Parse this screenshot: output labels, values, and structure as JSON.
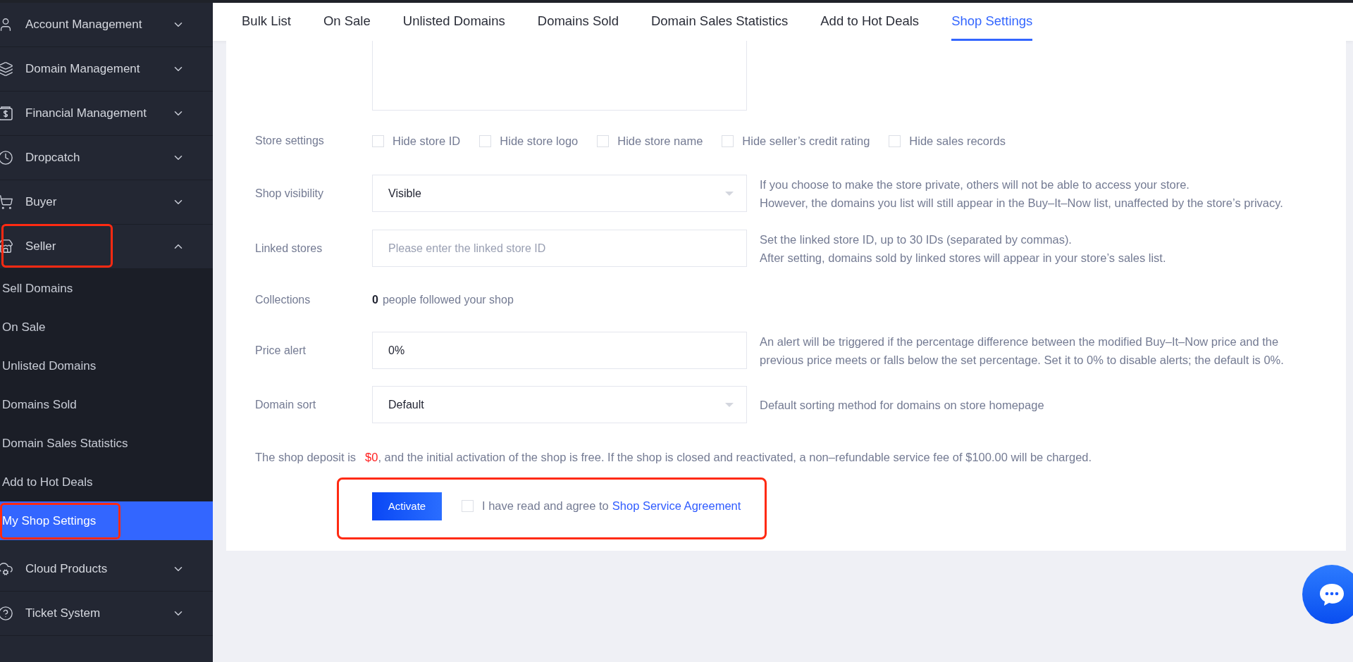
{
  "sidebar": {
    "items": [
      {
        "label": "Account Management",
        "expanded": false,
        "highlighted": false
      },
      {
        "label": "Domain Management",
        "expanded": false,
        "highlighted": false
      },
      {
        "label": "Financial Management",
        "expanded": false,
        "highlighted": false
      },
      {
        "label": "Dropcatch",
        "expanded": false,
        "highlighted": false
      },
      {
        "label": "Buyer",
        "expanded": false,
        "highlighted": false
      },
      {
        "label": "Seller",
        "expanded": true,
        "highlighted": true,
        "children": [
          {
            "label": "Sell Domains",
            "selected": false,
            "highlighted": false
          },
          {
            "label": "On Sale",
            "selected": false,
            "highlighted": false
          },
          {
            "label": "Unlisted Domains",
            "selected": false,
            "highlighted": false
          },
          {
            "label": "Domains Sold",
            "selected": false,
            "highlighted": false
          },
          {
            "label": "Domain Sales Statistics",
            "selected": false,
            "highlighted": false
          },
          {
            "label": "Add to Hot Deals",
            "selected": false,
            "highlighted": false
          },
          {
            "label": "My Shop Settings",
            "selected": true,
            "highlighted": true
          }
        ]
      },
      {
        "label": "Cloud Products",
        "expanded": false,
        "highlighted": false
      },
      {
        "label": "Ticket System",
        "expanded": false,
        "highlighted": false
      }
    ]
  },
  "tabs": [
    {
      "label": "Bulk List",
      "selected": false
    },
    {
      "label": "On Sale",
      "selected": false
    },
    {
      "label": "Unlisted Domains",
      "selected": false
    },
    {
      "label": "Domains Sold",
      "selected": false
    },
    {
      "label": "Domain Sales Statistics",
      "selected": false
    },
    {
      "label": "Add to Hot Deals",
      "selected": false
    },
    {
      "label": "Shop Settings",
      "selected": true
    }
  ],
  "form": {
    "store_settings": {
      "label": "Store settings",
      "options": [
        {
          "label": "Hide store ID",
          "checked": false
        },
        {
          "label": "Hide store logo",
          "checked": false
        },
        {
          "label": "Hide store name",
          "checked": false
        },
        {
          "label": "Hide seller’s credit rating",
          "checked": false
        },
        {
          "label": "Hide sales records",
          "checked": false
        }
      ]
    },
    "shop_visibility": {
      "label": "Shop visibility",
      "value": "Visible",
      "hint": [
        "If you choose to make the store private, others will not be able to access your store.",
        "However, the domains you list will still appear in the Buy–It–Now list, unaffected by the store’s privacy."
      ]
    },
    "linked_stores": {
      "label": "Linked stores",
      "placeholder": "Please enter the linked store ID",
      "hint": [
        "Set the linked store ID, up to 30 IDs (separated by commas).",
        "After setting, domains sold by linked stores will appear in your store’s sales list."
      ]
    },
    "collections": {
      "label": "Collections",
      "count": "0",
      "text": "people followed your shop"
    },
    "price_alert": {
      "label": "Price alert",
      "value": "0%",
      "hint": [
        "An alert will be triggered if the percentage difference between the modified Buy–It–Now price and the",
        "previous price meets or falls below the set percentage. Set it to 0% to disable alerts; the default is 0%."
      ]
    },
    "domain_sort": {
      "label": "Domain sort",
      "value": "Default",
      "hint": [
        "Default sorting method for domains on store homepage"
      ]
    },
    "deposit": {
      "prefix": "The shop deposit is",
      "amount": "$0",
      "suffix": ", and the initial activation of the shop is free. If the shop is closed and reactivated, a non–refundable service fee of $100.00 will be charged."
    },
    "activate": {
      "button": "Activate",
      "agree_checked": false,
      "agree_text": "I have read and agree to",
      "agree_link": "Shop Service Agreement",
      "highlighted": true
    }
  }
}
